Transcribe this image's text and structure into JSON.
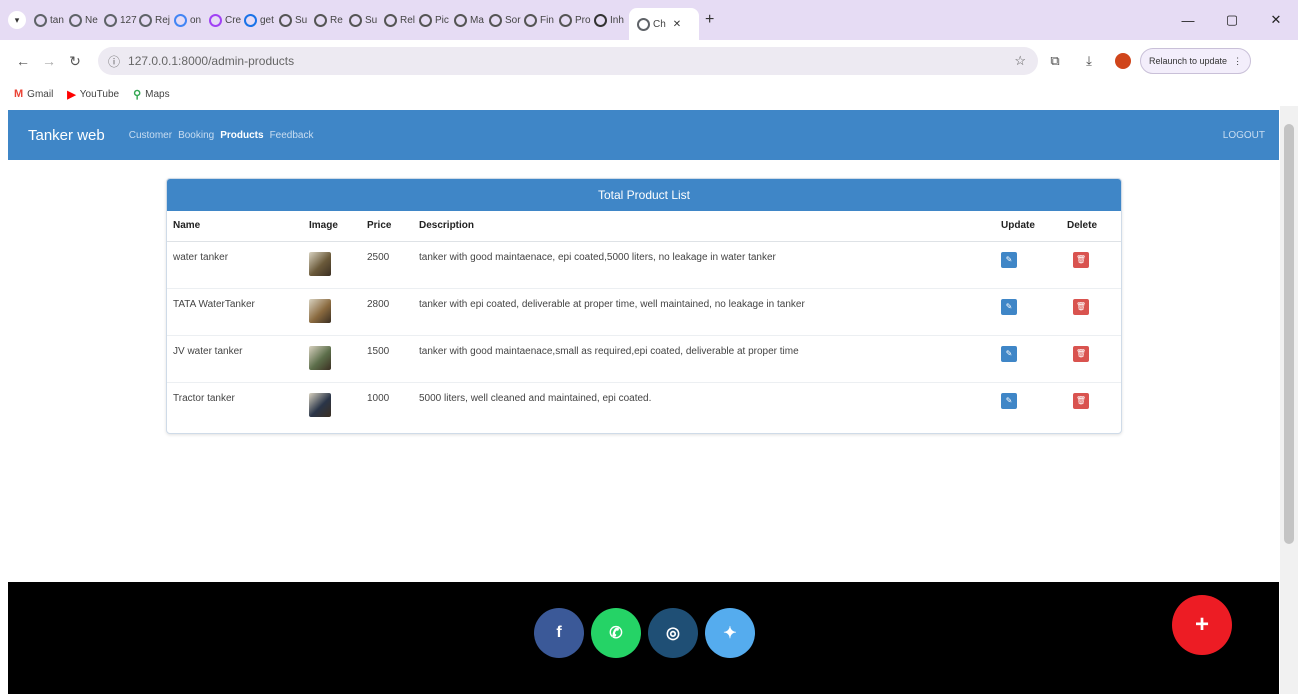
{
  "browser": {
    "tabs": [
      {
        "label": "tan",
        "icon": "chrome-icon",
        "color": "#5f6368"
      },
      {
        "label": "Ne",
        "icon": "chrome-icon",
        "color": "#5f6368"
      },
      {
        "label": "127",
        "icon": "chrome-icon",
        "color": "#5f6368"
      },
      {
        "label": "Rej",
        "icon": "chrome-icon",
        "color": "#5f6368"
      },
      {
        "label": "on",
        "icon": "google-icon",
        "color": "#4285f4"
      },
      {
        "label": "Cre",
        "icon": "gmail-icon",
        "color": "#a142f4"
      },
      {
        "label": "get",
        "icon": "filter-icon",
        "color": "#1a73e8"
      },
      {
        "label": "Su",
        "icon": "c-icon",
        "color": "#555555"
      },
      {
        "label": "Re",
        "icon": "c-icon",
        "color": "#555555"
      },
      {
        "label": "Su",
        "icon": "c-icon",
        "color": "#555555"
      },
      {
        "label": "Rel",
        "icon": "c-icon",
        "color": "#555555"
      },
      {
        "label": "Pic",
        "icon": "c-icon",
        "color": "#555555"
      },
      {
        "label": "Ma",
        "icon": "c-icon",
        "color": "#555555"
      },
      {
        "label": "Sor",
        "icon": "c-icon",
        "color": "#555555"
      },
      {
        "label": "Fin",
        "icon": "c-icon",
        "color": "#555555"
      },
      {
        "label": "Pro",
        "icon": "c-icon",
        "color": "#555555"
      },
      {
        "label": "Inh",
        "icon": "square-icon",
        "color": "#333333"
      },
      {
        "label": "Ch",
        "icon": "gear-icon",
        "color": "#5f6368"
      }
    ],
    "url": "127.0.0.1:8000/admin-products",
    "relaunch_label": "Relaunch to update",
    "bookmarks": [
      {
        "label": "Gmail",
        "icon": "gmail-icon",
        "color": "#ea4335"
      },
      {
        "label": "YouTube",
        "icon": "youtube-icon",
        "color": "#ff0000"
      },
      {
        "label": "Maps",
        "icon": "maps-pin-icon",
        "color": "#34a853"
      }
    ]
  },
  "nav": {
    "brand": "Tanker web",
    "links": [
      "Customer",
      "Booking",
      "Products",
      "Feedback"
    ],
    "active": "Products",
    "logout": "LOGOUT",
    "color": "#3f86c7"
  },
  "products": {
    "title": "Total Product List",
    "headers": {
      "name": "Name",
      "image": "Image",
      "price": "Price",
      "description": "Description",
      "update": "Update",
      "delete": "Delete"
    },
    "rows": [
      {
        "name": "water tanker",
        "price": "2500",
        "description": "tanker with good maintaenace, epi coated,5000 liters, no leakage in water tanker",
        "thumb": "#6b5a3a"
      },
      {
        "name": "TATA WaterTanker",
        "price": "2800",
        "description": "tanker with epi coated, deliverable at proper time, well maintained, no leakage in tanker",
        "thumb": "#8a6a3f"
      },
      {
        "name": "JV water tanker",
        "price": "1500",
        "description": "tanker with good maintaenace,small as required,epi coated, deliverable at proper time",
        "thumb": "#5c6e4a"
      },
      {
        "name": "Tractor tanker",
        "price": "1000",
        "description": "5000 liters, well cleaned and maintained, epi coated.",
        "thumb": "#2a3548"
      }
    ],
    "update_color": "#3f86c7",
    "delete_color": "#d9534f"
  },
  "footer": {
    "social": [
      {
        "name": "facebook",
        "glyph": "f",
        "color": "#3b5998"
      },
      {
        "name": "whatsapp",
        "glyph": "✆",
        "color": "#25d366"
      },
      {
        "name": "instagram",
        "glyph": "◎",
        "color": "#1f4f75"
      },
      {
        "name": "twitter",
        "glyph": "✦",
        "color": "#55acee"
      }
    ],
    "fab_glyph": "+",
    "fab_color": "#ed1c24"
  }
}
